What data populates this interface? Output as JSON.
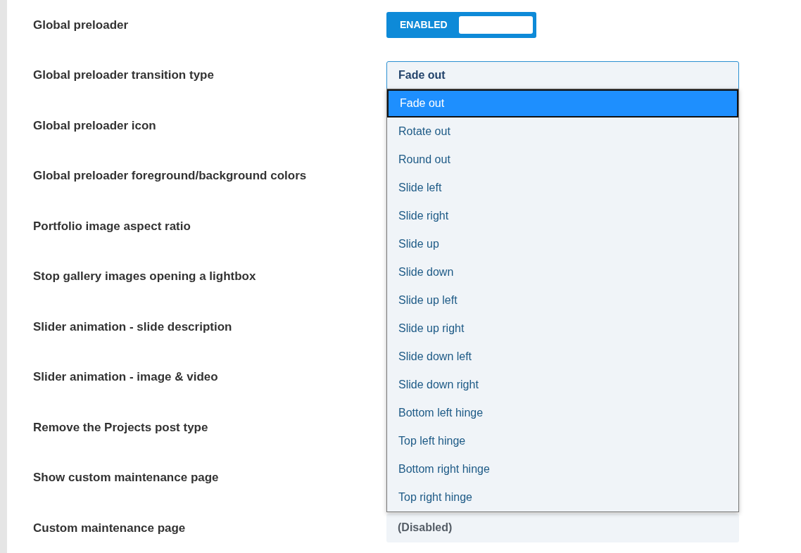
{
  "settings": [
    {
      "label": "Global preloader",
      "control": {
        "kind": "toggle",
        "text": "ENABLED",
        "on": true
      }
    },
    {
      "label": "Global preloader transition type",
      "control": {
        "kind": "select",
        "value": "Fade out",
        "open": true,
        "options": [
          {
            "label": "Fade out",
            "selected": true
          },
          {
            "label": "Rotate out",
            "selected": false
          },
          {
            "label": "Round out",
            "selected": false
          },
          {
            "label": "Slide left",
            "selected": false
          },
          {
            "label": "Slide right",
            "selected": false
          },
          {
            "label": "Slide up",
            "selected": false
          },
          {
            "label": "Slide down",
            "selected": false
          },
          {
            "label": "Slide up left",
            "selected": false
          },
          {
            "label": "Slide up right",
            "selected": false
          },
          {
            "label": "Slide down left",
            "selected": false
          },
          {
            "label": "Slide down right",
            "selected": false
          },
          {
            "label": "Bottom left hinge",
            "selected": false
          },
          {
            "label": "Top left hinge",
            "selected": false
          },
          {
            "label": "Bottom right hinge",
            "selected": false
          },
          {
            "label": "Top right hinge",
            "selected": false
          }
        ]
      }
    },
    {
      "label": "Global preloader icon"
    },
    {
      "label": "Global preloader foreground/background colors"
    },
    {
      "label": "Portfolio image aspect ratio"
    },
    {
      "label": "Stop gallery images opening a lightbox"
    },
    {
      "label": "Slider animation - slide description"
    },
    {
      "label": "Slider animation - image & video"
    },
    {
      "label": "Remove the Projects post type"
    },
    {
      "label": "Show custom maintenance page"
    },
    {
      "label": "Custom maintenance page",
      "control": {
        "kind": "select",
        "value": "(Disabled)",
        "open": false,
        "disabled": true
      }
    }
  ]
}
